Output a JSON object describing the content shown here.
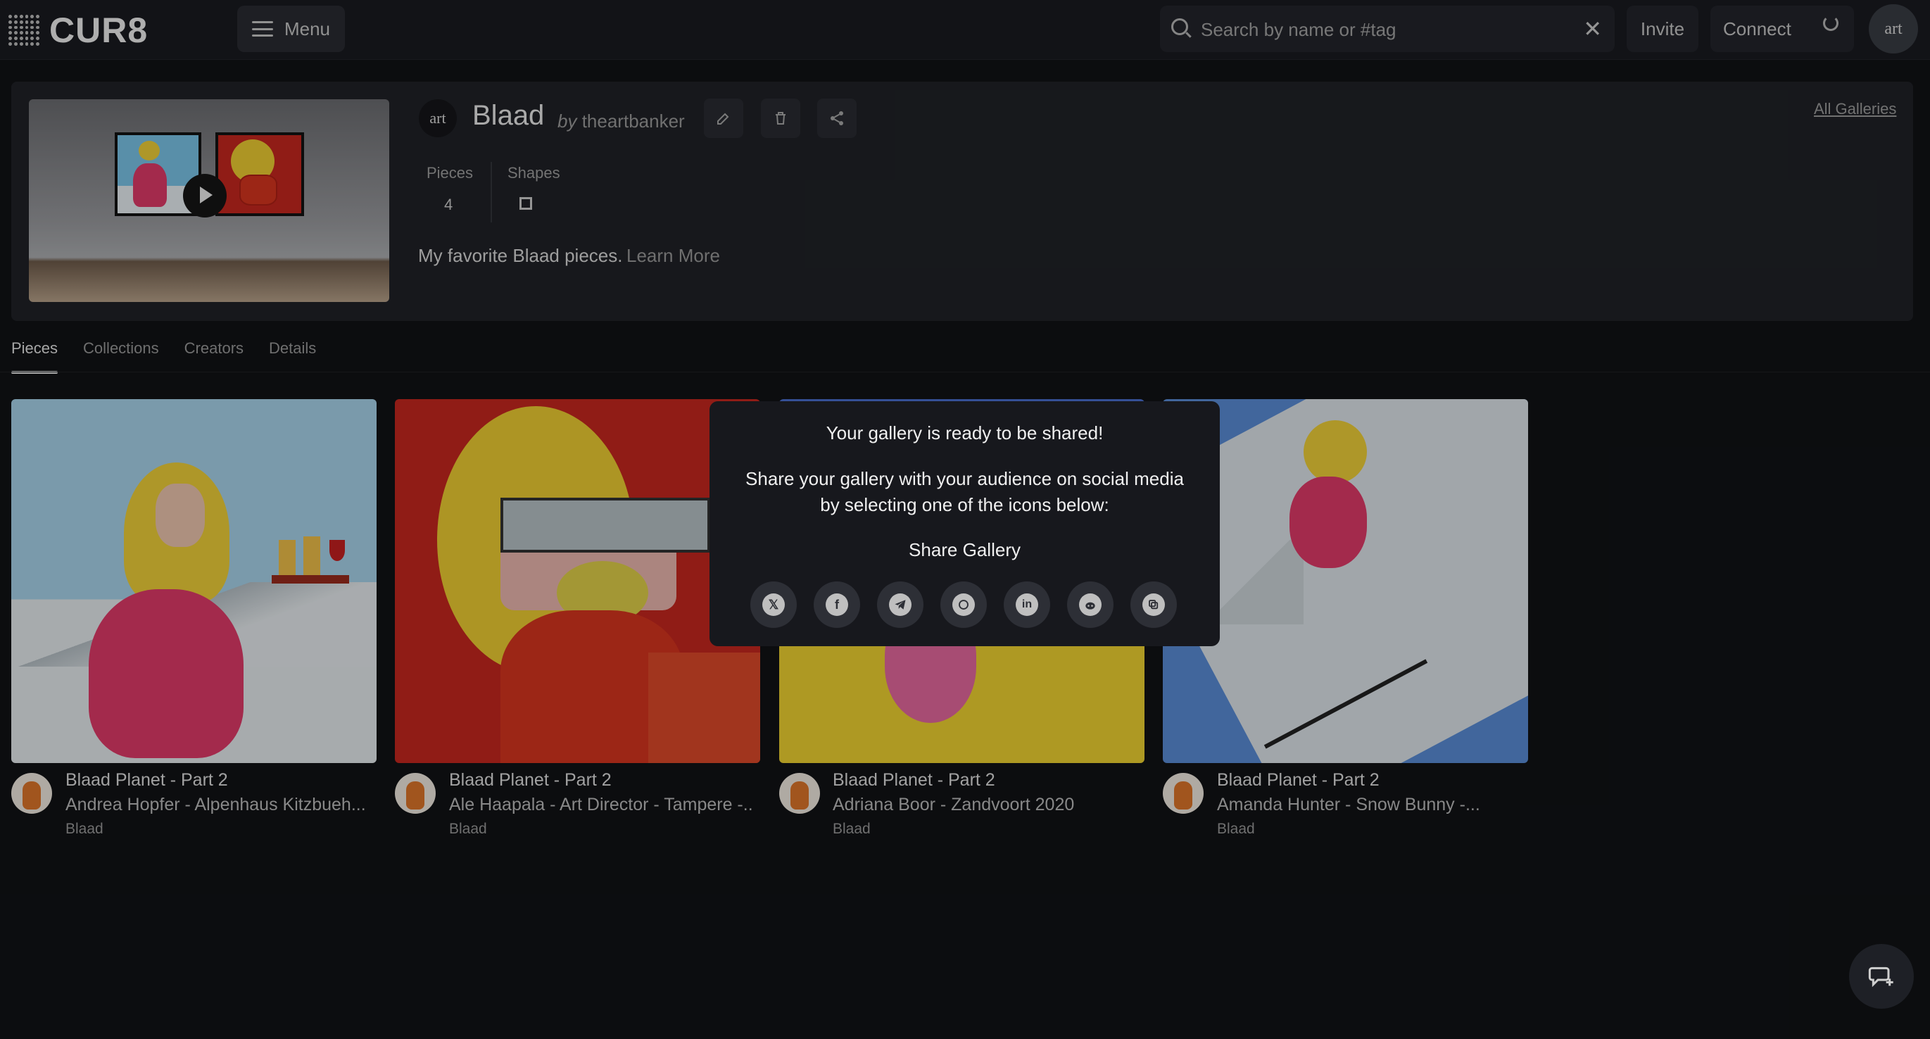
{
  "app": {
    "logo_text": "CUR8",
    "menu_label": "Menu"
  },
  "search": {
    "placeholder": "Search by name or #tag",
    "clear_symbol": "✕"
  },
  "topbar": {
    "invite_label": "Invite",
    "connect_label": "Connect",
    "avatar_text": "art"
  },
  "gallery": {
    "avatar_text": "art",
    "title": "Blaad",
    "by_prefix": "by",
    "owner": "theartbanker",
    "all_galleries_label": "All Galleries",
    "stats": {
      "pieces_label": "Pieces",
      "pieces_value": "4",
      "shapes_label": "Shapes"
    },
    "description": "My favorite Blaad pieces.",
    "learn_more": "Learn More"
  },
  "tabs": [
    {
      "label": "Pieces",
      "active": true
    },
    {
      "label": "Collections",
      "active": false
    },
    {
      "label": "Creators",
      "active": false
    },
    {
      "label": "Details",
      "active": false
    }
  ],
  "cards": [
    {
      "title": "Blaad Planet - Part 2",
      "subtitle": "Andrea Hopfer - Alpenhaus Kitzbueh...",
      "creator": "Blaad"
    },
    {
      "title": "Blaad Planet - Part 2",
      "subtitle": "Ale Haapala - Art Director - Tampere -...",
      "creator": "Blaad"
    },
    {
      "title": "Blaad Planet - Part 2",
      "subtitle": "Adriana Boor - Zandvoort 2020",
      "creator": "Blaad"
    },
    {
      "title": "Blaad Planet - Part 2",
      "subtitle": "Amanda Hunter - Snow Bunny -...",
      "creator": "Blaad"
    }
  ],
  "share_modal": {
    "title": "Your gallery is ready to be shared!",
    "body": "Share your gallery with your audience on social media by selecting one of the icons below:",
    "share_label": "Share Gallery",
    "icons": [
      "x-icon",
      "facebook-icon",
      "telegram-icon",
      "whatsapp-icon",
      "linkedin-icon",
      "reddit-icon",
      "copy-link-icon"
    ]
  },
  "colors": {
    "background": "#111216",
    "panel": "#202227",
    "modal": "#17181d",
    "accent_text": "#e6e6e6"
  }
}
